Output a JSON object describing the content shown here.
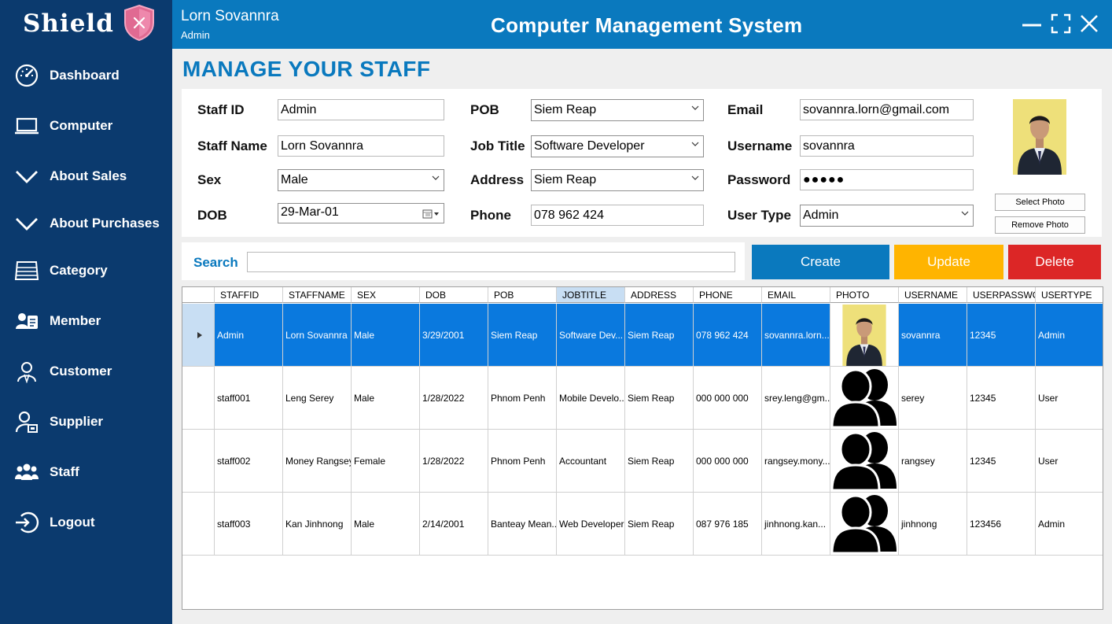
{
  "brand": {
    "name": "Shield",
    "logo_icon": "shield-icon"
  },
  "sidebar": {
    "items": [
      {
        "label": "Dashboard",
        "icon": "speedometer-icon"
      },
      {
        "label": "Computer",
        "icon": "laptop-icon"
      },
      {
        "label": "About Sales",
        "icon": "chevron-down-icon"
      },
      {
        "label": "About Purchases",
        "icon": "chevron-down-icon"
      },
      {
        "label": "Category",
        "icon": "keyboard-icon"
      },
      {
        "label": "Member",
        "icon": "member-card-icon"
      },
      {
        "label": "Customer",
        "icon": "customer-icon"
      },
      {
        "label": "Supplier",
        "icon": "supplier-icon"
      },
      {
        "label": "Staff",
        "icon": "staff-group-icon"
      },
      {
        "label": "Logout",
        "icon": "logout-icon"
      }
    ]
  },
  "header": {
    "user_name": "Lorn Sovannra",
    "user_role": "Admin",
    "title": "Computer Management System"
  },
  "page": {
    "title": "MANAGE YOUR STAFF"
  },
  "form": {
    "staff_id": {
      "label": "Staff ID",
      "value": "Admin"
    },
    "staff_name": {
      "label": "Staff Name",
      "value": "Lorn Sovannra"
    },
    "sex": {
      "label": "Sex",
      "value": "Male"
    },
    "dob": {
      "label": "DOB",
      "value": "29-Mar-01"
    },
    "pob": {
      "label": "POB",
      "value": "Siem Reap"
    },
    "job_title": {
      "label": "Job Title",
      "value": "Software Developer"
    },
    "address": {
      "label": "Address",
      "value": "Siem Reap"
    },
    "phone": {
      "label": "Phone",
      "value": "078 962 424"
    },
    "email": {
      "label": "Email",
      "value": "sovannra.lorn@gmail.com"
    },
    "username": {
      "label": "Username",
      "value": "sovannra"
    },
    "password": {
      "label": "Password",
      "value": "●●●●●"
    },
    "user_type": {
      "label": "User Type",
      "value": "Admin"
    },
    "select_photo": "Select Photo",
    "remove_photo": "Remove Photo"
  },
  "search": {
    "label": "Search",
    "value": ""
  },
  "actions": {
    "create": "Create",
    "update": "Update",
    "delete": "Delete"
  },
  "colors": {
    "sidebar": "#0b3a6e",
    "header": "#0a79be",
    "create": "#0a79be",
    "update": "#ffb400",
    "delete": "#dc2626",
    "selected_row": "#0a79de"
  },
  "grid": {
    "columns": [
      "STAFFID",
      "STAFFNAME",
      "SEX",
      "DOB",
      "POB",
      "JOBTITLE",
      "ADDRESS",
      "PHONE",
      "EMAIL",
      "PHOTO",
      "USERNAME",
      "USERPASSWO",
      "USERTYPE"
    ],
    "selected_column": "JOBTITLE",
    "rows": [
      {
        "staffid": "Admin",
        "staffname": "Lorn Sovannra",
        "sex": "Male",
        "dob": "3/29/2001",
        "pob": "Siem Reap",
        "jobtitle": "Software Dev...",
        "address": "Siem Reap",
        "phone": "078 962 424",
        "email": "sovannra.lorn...",
        "photo": "portrait-photo",
        "username": "sovannra",
        "password": "12345",
        "usertype": "Admin"
      },
      {
        "staffid": "staff001",
        "staffname": "Leng Serey",
        "sex": "Male",
        "dob": "1/28/2022",
        "pob": "Phnom Penh",
        "jobtitle": "Mobile Develo...",
        "address": "Siem Reap",
        "phone": "000 000 000",
        "email": "srey.leng@gm...",
        "photo": "default-users-icon",
        "username": "serey",
        "password": "12345",
        "usertype": "User"
      },
      {
        "staffid": "staff002",
        "staffname": "Money Rangsey",
        "sex": "Female",
        "dob": "1/28/2022",
        "pob": "Phnom Penh",
        "jobtitle": "Accountant",
        "address": "Siem Reap",
        "phone": "000 000 000",
        "email": "rangsey.mony...",
        "photo": "default-users-icon",
        "username": "rangsey",
        "password": "12345",
        "usertype": "User"
      },
      {
        "staffid": "staff003",
        "staffname": "Kan Jinhnong",
        "sex": "Male",
        "dob": "2/14/2001",
        "pob": "Banteay Mean...",
        "jobtitle": "Web Developer",
        "address": "Siem Reap",
        "phone": "087 976 185",
        "email": "jinhnong.kan...",
        "photo": "default-users-icon",
        "username": "jinhnong",
        "password": "123456",
        "usertype": "Admin"
      }
    ]
  }
}
